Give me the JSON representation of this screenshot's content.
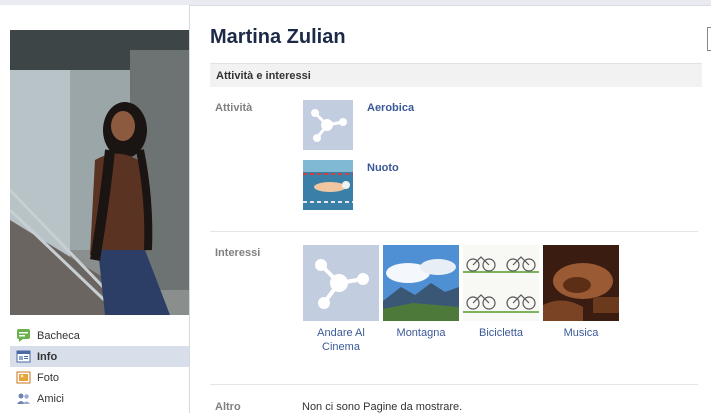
{
  "profile": {
    "name": "Martina Zulian"
  },
  "sidebar": {
    "items": [
      {
        "label": "Bacheca",
        "icon": "wall-icon",
        "active": false
      },
      {
        "label": "Info",
        "icon": "info-icon",
        "active": true
      },
      {
        "label": "Foto",
        "icon": "photos-icon",
        "active": false
      },
      {
        "label": "Amici",
        "icon": "friends-icon",
        "active": false
      }
    ]
  },
  "section": {
    "title": "Attività e interessi"
  },
  "activities": {
    "label": "Attività",
    "items": [
      {
        "title": "Aerobica",
        "icon": "placeholder-icon"
      },
      {
        "title": "Nuoto",
        "icon": "swimming-photo"
      }
    ]
  },
  "interests": {
    "label": "Interessi",
    "items": [
      {
        "title": "Andare Al Cinema",
        "icon": "placeholder-icon"
      },
      {
        "title": "Montagna",
        "icon": "mountain-photo"
      },
      {
        "title": "Bicicletta",
        "icon": "bicycles-photo"
      },
      {
        "title": "Musica",
        "icon": "music-photo"
      }
    ]
  },
  "other": {
    "label": "Altro",
    "text": "Non ci sono Pagine da mostrare."
  },
  "colors": {
    "link": "#3b5998",
    "name": "#1c2a47",
    "active_nav": "#d8dfea"
  }
}
